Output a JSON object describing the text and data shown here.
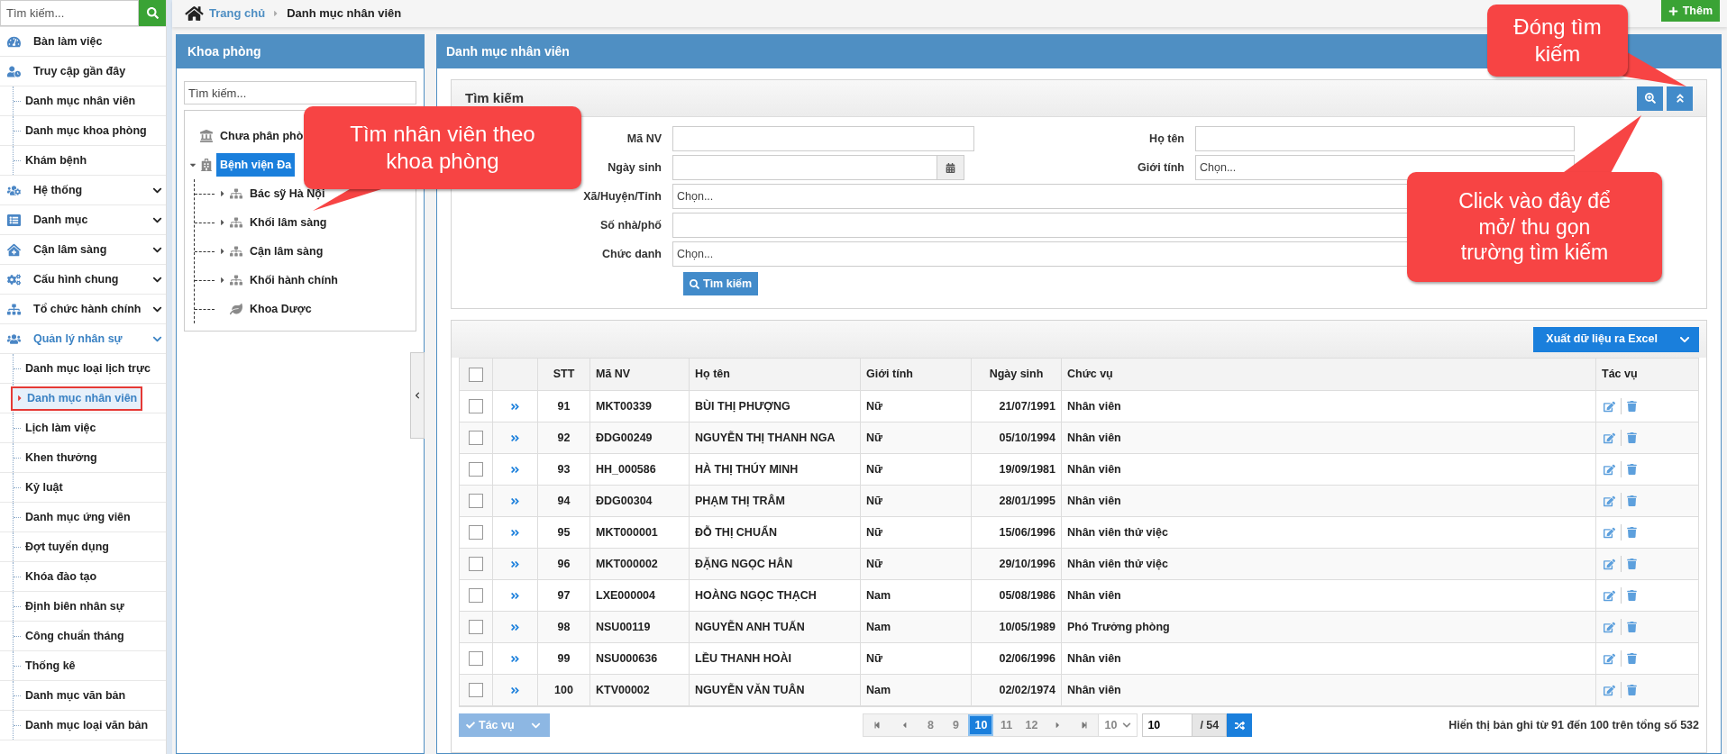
{
  "breadcrumb": [
    {
      "label": "Trang chủ",
      "kind": "link"
    },
    {
      "label": "Danh mục nhân viên",
      "kind": "current"
    }
  ],
  "add_button": "Thêm",
  "sidebar": {
    "search": {
      "placeholder": "Tìm kiếm..."
    },
    "items": [
      {
        "label": "Bàn làm việc"
      },
      {
        "label": "Truy cập gần đây",
        "children": [
          {
            "label": "Danh mục nhân viên",
            "selected": false
          },
          {
            "label": "Danh mục khoa phòng",
            "selected": false
          },
          {
            "label": "Khám bệnh",
            "selected": false
          }
        ]
      },
      {
        "label": "Hệ thống",
        "expanded": false
      },
      {
        "label": "Danh mục",
        "expanded": false
      },
      {
        "label": "Cận lâm sàng",
        "expanded": false
      },
      {
        "label": "Cấu hình chung",
        "expanded": false
      },
      {
        "label": "Tổ chức hành chính",
        "expanded": false
      },
      {
        "label": "Quản lý nhân sự",
        "expanded": true,
        "children": [
          {
            "label": "Danh mục loại lịch trực",
            "selected": false
          },
          {
            "label": "Danh mục nhân viên",
            "selected": true
          },
          {
            "label": "Lịch làm việc",
            "selected": false
          },
          {
            "label": "Khen thưởng",
            "selected": false
          },
          {
            "label": "Kỷ luật",
            "selected": false
          },
          {
            "label": "Danh mục ứng viên",
            "selected": false
          },
          {
            "label": "Đợt tuyển dụng",
            "selected": false
          },
          {
            "label": "Khóa đào tạo",
            "selected": false
          },
          {
            "label": "Định biên nhân sự",
            "selected": false
          },
          {
            "label": "Công chuẩn tháng",
            "selected": false
          },
          {
            "label": "Thống kê",
            "selected": false
          },
          {
            "label": "Danh mục văn bản",
            "selected": false
          },
          {
            "label": "Danh mục loại văn bản",
            "selected": false
          }
        ]
      }
    ]
  },
  "department_panel": {
    "title": "Khoa phòng",
    "search": {
      "placeholder": "Tìm kiếm..."
    },
    "tree": [
      {
        "label": "Chưa phân phò",
        "kind": "unassigned",
        "selected": false
      },
      {
        "label": "Bệnh viện Đa",
        "kind": "hospital",
        "selected": true,
        "expanded": true,
        "children": [
          {
            "label": "Bác sỹ Hà Nội",
            "kind": "unit",
            "selected": false,
            "expanded": false
          },
          {
            "label": "Khối lâm sàng",
            "kind": "unit",
            "selected": false,
            "expanded": false
          },
          {
            "label": "Cận lâm sàng",
            "kind": "unit",
            "selected": false,
            "expanded": false
          },
          {
            "label": "Khối hành chính",
            "kind": "unit",
            "selected": false,
            "expanded": false
          },
          {
            "label": "Khoa Dược",
            "kind": "leaf",
            "selected": false
          }
        ]
      }
    ]
  },
  "main_panel": {
    "title": "Danh mục nhân viên",
    "search": {
      "title": "Tìm kiếm",
      "rows": [
        {
          "fields": [
            {
              "label": "Mã NV",
              "kind": "text"
            },
            {
              "label": "Họ tên",
              "kind": "text"
            }
          ]
        },
        {
          "fields": [
            {
              "label": "Ngày sinh",
              "kind": "date"
            },
            {
              "label": "Giới tính",
              "kind": "select",
              "placeholder": "Chọn..."
            }
          ]
        },
        {
          "fields": [
            {
              "label": "Xã/Huyện/Tỉnh",
              "kind": "select",
              "placeholder": "Chọn..."
            }
          ]
        },
        {
          "fields": [
            {
              "label": "Số nhà/phố",
              "kind": "text"
            }
          ]
        },
        {
          "fields": [
            {
              "label": "Chức danh",
              "kind": "select",
              "placeholder": "Chọn..."
            }
          ]
        }
      ],
      "button": "Tìm kiếm"
    },
    "table": {
      "export_button": "Xuất dữ liệu ra Excel",
      "header_checked": false,
      "columns": [
        "STT",
        "Mã NV",
        "Họ tên",
        "Giới tính",
        "Ngày sinh",
        "Chức vụ",
        "Tác vụ"
      ],
      "rows": [
        {
          "checked": false,
          "stt": "91",
          "code": "MKT00339",
          "name": "BÙI THỊ PHƯỢNG",
          "gender": "Nữ",
          "dob": "21/07/1991",
          "position": "Nhân viên"
        },
        {
          "checked": false,
          "stt": "92",
          "code": "ĐDG00249",
          "name": "NGUYỄN THỊ THANH NGA",
          "gender": "Nữ",
          "dob": "05/10/1994",
          "position": "Nhân viên"
        },
        {
          "checked": false,
          "stt": "93",
          "code": "HH_000586",
          "name": "HÀ THỊ THÚY MINH",
          "gender": "Nữ",
          "dob": "19/09/1981",
          "position": "Nhân viên"
        },
        {
          "checked": false,
          "stt": "94",
          "code": "ĐDG00304",
          "name": "PHẠM THỊ TRÂM",
          "gender": "Nữ",
          "dob": "28/01/1995",
          "position": "Nhân viên"
        },
        {
          "checked": false,
          "stt": "95",
          "code": "MKT000001",
          "name": "ĐỖ THỊ CHUẨN",
          "gender": "Nữ",
          "dob": "15/06/1996",
          "position": "Nhân viên thử việc"
        },
        {
          "checked": false,
          "stt": "96",
          "code": "MKT000002",
          "name": "ĐẶNG NGỌC HÂN",
          "gender": "Nữ",
          "dob": "29/10/1996",
          "position": "Nhân viên thử việc"
        },
        {
          "checked": false,
          "stt": "97",
          "code": "LXE000004",
          "name": "HOÀNG NGỌC THẠCH",
          "gender": "Nam",
          "dob": "05/08/1986",
          "position": "Nhân viên"
        },
        {
          "checked": false,
          "stt": "98",
          "code": "NSU00119",
          "name": "NGUYỄN ANH TUẤN",
          "gender": "Nam",
          "dob": "10/05/1989",
          "position": "Phó Trưởng phòng"
        },
        {
          "checked": false,
          "stt": "99",
          "code": "NSU000636",
          "name": "LỀU THANH HOÀI",
          "gender": "Nữ",
          "dob": "02/06/1996",
          "position": "Nhân viên"
        },
        {
          "checked": false,
          "stt": "100",
          "code": "KTV00002",
          "name": "NGUYỄN VĂN TUÂN",
          "gender": "Nam",
          "dob": "02/02/1974",
          "position": "Nhân viên"
        }
      ]
    },
    "footer": {
      "action_button": {
        "label": "Tác vụ",
        "disabled": true
      },
      "pagination": {
        "pages": [
          {
            "label": "8",
            "selected": false
          },
          {
            "label": "9",
            "selected": false
          },
          {
            "label": "10",
            "selected": true
          },
          {
            "label": "11",
            "selected": false
          },
          {
            "label": "12",
            "selected": false
          }
        ],
        "page_size": "10",
        "page_input": "10",
        "total_pages": "/ 54"
      },
      "summary": "Hiển thị bản ghi từ 91 đến 100 trên tổng số 532"
    }
  },
  "callouts": [
    {
      "text": "Tìm nhân viên theo khoa phòng"
    },
    {
      "text": "Đóng tìm kiếm"
    },
    {
      "text": "Click vào đây để mở/ thu gọn trường tìm kiếm"
    }
  ]
}
